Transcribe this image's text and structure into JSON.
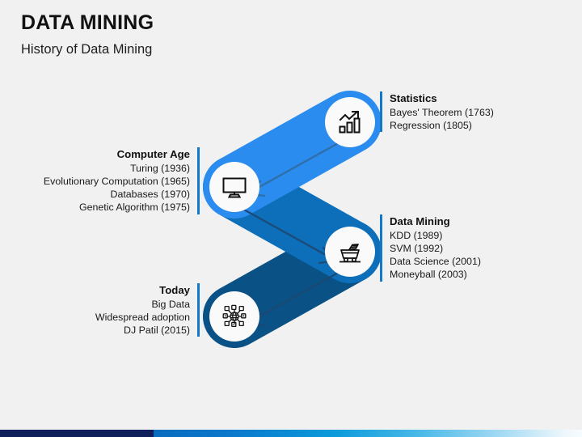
{
  "header": {
    "title": "DATA MINING",
    "subtitle": "History of Data Mining"
  },
  "colors": {
    "background": "#f1f1f1",
    "ribbon_light": "#2b8cf0",
    "ribbon_medium": "#0d6fba",
    "ribbon_dark": "#0a5186",
    "accent_bar": "#1477c8",
    "bottom_navy": "#0e1f5b",
    "bottom_cyan": "#0b9ada",
    "text": "#1a1a1a"
  },
  "stages": [
    {
      "key": "statistics",
      "title": "Statistics",
      "icon": "chart-growth-icon",
      "side": "right",
      "items": [
        "Bayes' Theorem (1763)",
        "Regression (1805)"
      ]
    },
    {
      "key": "computer_age",
      "title": "Computer Age",
      "icon": "desktop-monitor-icon",
      "side": "left",
      "items": [
        "Turing (1936)",
        "Evolutionary Computation (1965)",
        "Databases (1970)",
        "Genetic Algorithm (1975)"
      ]
    },
    {
      "key": "data_mining",
      "title": "Data Mining",
      "icon": "mining-cart-icon",
      "side": "right",
      "items": [
        "KDD (1989)",
        "SVM (1992)",
        "Data Science (2001)",
        "Moneyball (2003)"
      ]
    },
    {
      "key": "today",
      "title": "Today",
      "icon": "network-globe-icon",
      "side": "left",
      "items": [
        "Big Data",
        "Widespread adoption",
        "DJ Patil (2015)"
      ]
    }
  ]
}
